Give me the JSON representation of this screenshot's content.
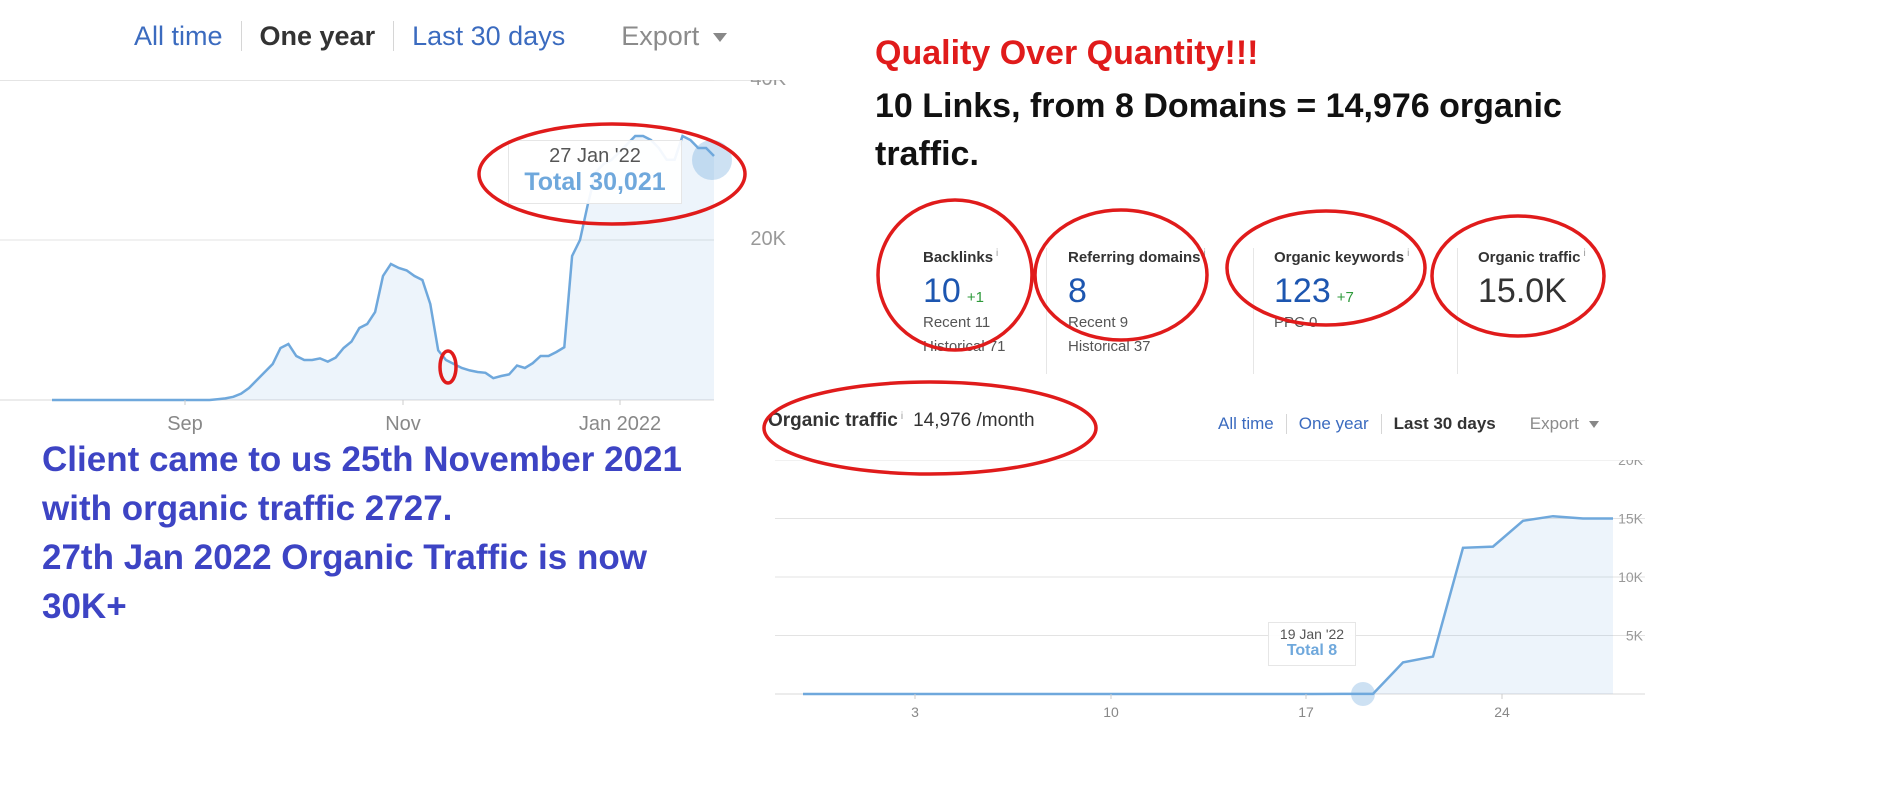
{
  "left_tabs": {
    "all_time": "All time",
    "one_year": "One year",
    "last_30_days": "Last 30 days",
    "export": "Export"
  },
  "left_tooltip": {
    "date": "27 Jan '22",
    "total": "Total 30,021"
  },
  "headline": {
    "red": "Quality Over Quantity!!!",
    "black": "10 Links, from 8 Domains = 14,976 organic traffic."
  },
  "metrics": [
    {
      "label": "Backlinks",
      "info": "i",
      "value": "10",
      "delta": "+1",
      "sub1": "Recent 11",
      "sub2": "Historical 71"
    },
    {
      "label": "Referring domains",
      "info": "i",
      "value": "8",
      "delta": "",
      "sub1": "Recent 9",
      "sub2": "Historical 37"
    },
    {
      "label": "Organic keywords",
      "info": "i",
      "value": "123",
      "delta": "+7",
      "sub1": "PPC 0",
      "sub2": ""
    },
    {
      "label": "Organic traffic",
      "info": "i",
      "value": "15.0K",
      "delta": "",
      "sub1": "",
      "sub2": ""
    }
  ],
  "organic_traffic_header": {
    "label": "Organic traffic",
    "info": "i",
    "value": "14,976 /month"
  },
  "right_tabs": {
    "all_time": "All time",
    "one_year": "One year",
    "last_30_days": "Last 30 days",
    "export": "Export"
  },
  "right_tooltip": {
    "date": "19 Jan '22",
    "total": "Total 8"
  },
  "caption": {
    "line1": "Client came to us 25th November 2021",
    "line2": "with organic traffic 2727.",
    "line3": "27th Jan 2022  Organic Traffic is now",
    "line4": "30K+"
  },
  "colors": {
    "accent_blue": "#3b6bbf",
    "line_blue": "#6fa8dc",
    "annotation_red": "#e01b1b",
    "caption_blue": "#3d44c4",
    "delta_green": "#2e9a3b"
  },
  "chart_data": [
    {
      "type": "area",
      "x_ticks": [
        "Sep",
        "Nov",
        "Jan 2022"
      ],
      "y_ticks": [
        "20K",
        "40K"
      ],
      "ylim": [
        0,
        40000
      ],
      "grid": true,
      "series": [
        {
          "values": [
            0,
            0,
            0,
            0,
            0,
            0,
            0,
            0,
            0,
            0,
            0,
            0,
            0,
            0,
            0,
            0,
            0,
            0,
            0,
            0,
            0,
            100,
            200,
            400,
            800,
            1500,
            2500,
            3500,
            4500,
            6500,
            7000,
            5500,
            5000,
            5000,
            5200,
            4800,
            5300,
            6500,
            7300,
            9000,
            9500,
            11000,
            15500,
            17000,
            16500,
            16200,
            15500,
            15000,
            12000,
            6200,
            5000,
            4500,
            4000,
            3700,
            3500,
            3400,
            2727,
            3000,
            3200,
            4300,
            4000,
            4600,
            5500,
            5500,
            6000,
            6600,
            18000,
            20000,
            24500,
            28500,
            29500,
            30021,
            31000,
            32000,
            33000,
            33000,
            32500,
            31500,
            30021,
            30021,
            33000,
            32500,
            31500,
            31500,
            30500
          ]
        }
      ]
    },
    {
      "type": "area",
      "x_ticks": [
        "3",
        "10",
        "17",
        "24"
      ],
      "y_ticks": [
        "5K",
        "10K",
        "15K",
        "20K"
      ],
      "ylim": [
        0,
        20000
      ],
      "grid": true,
      "series": [
        {
          "values": [
            0,
            0,
            0,
            0,
            0,
            0,
            0,
            0,
            0,
            0,
            0,
            0,
            0,
            0,
            0,
            0,
            0,
            0,
            8,
            8,
            2700,
            3200,
            12500,
            12600,
            14800,
            15200,
            15000,
            15000
          ]
        }
      ]
    }
  ]
}
